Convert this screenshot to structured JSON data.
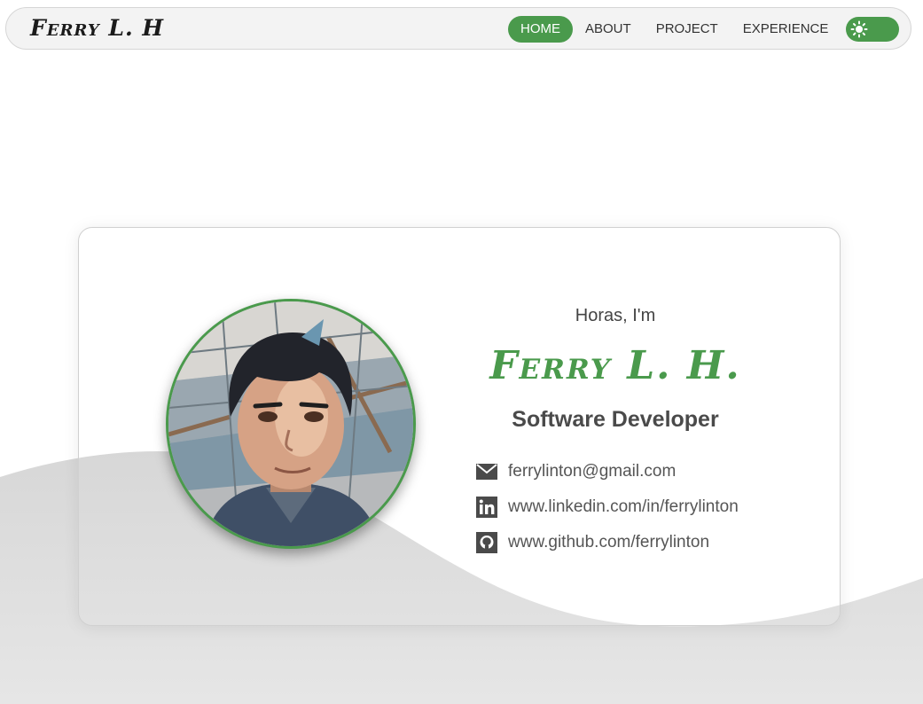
{
  "nav": {
    "brand": "Ferry L. H",
    "items": [
      {
        "label": "HOME",
        "active": true
      },
      {
        "label": "ABOUT",
        "active": false
      },
      {
        "label": "PROJECT",
        "active": false
      },
      {
        "label": "EXPERIENCE",
        "active": false
      }
    ],
    "theme_toggle_icon": "sun-icon"
  },
  "hero": {
    "greeting": "Horas, I'm",
    "name": "Ferry L. H.",
    "role": "Software Developer",
    "contacts": [
      {
        "icon": "mail-icon",
        "text": "ferrylinton@gmail.com"
      },
      {
        "icon": "linkedin-icon",
        "text": "www.linkedin.com/in/ferrylinton"
      },
      {
        "icon": "github-icon",
        "text": "www.github.com/ferrylinton"
      }
    ]
  },
  "colors": {
    "accent": "#4a9a4c",
    "text": "#444444",
    "wave": "#e3e3e3"
  }
}
